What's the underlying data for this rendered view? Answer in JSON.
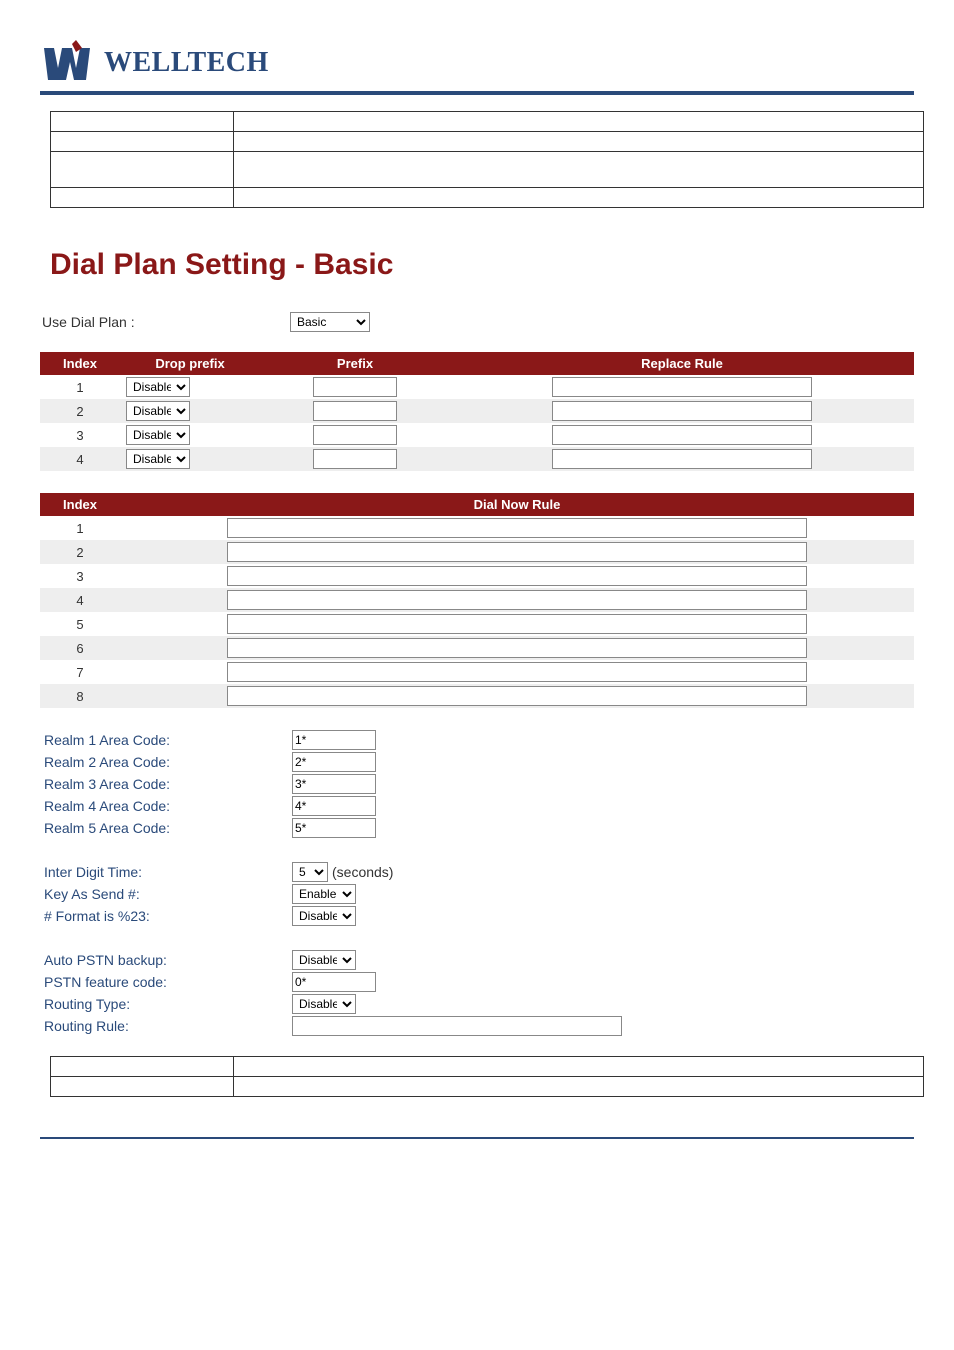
{
  "logo_text": "WELLTECH",
  "title": "Dial Plan Setting - Basic",
  "use_dial_plan": {
    "label": "Use Dial Plan :",
    "value": "Basic"
  },
  "plan_headers": {
    "index": "Index",
    "drop_prefix": "Drop prefix",
    "prefix": "Prefix",
    "replace": "Replace Rule"
  },
  "plan_rows": [
    {
      "index": "1",
      "drop": "Disable",
      "prefix": "",
      "replace": ""
    },
    {
      "index": "2",
      "drop": "Disable",
      "prefix": "",
      "replace": ""
    },
    {
      "index": "3",
      "drop": "Disable",
      "prefix": "",
      "replace": ""
    },
    {
      "index": "4",
      "drop": "Disable",
      "prefix": "",
      "replace": ""
    }
  ],
  "dialnow_headers": {
    "index": "Index",
    "rule": "Dial Now Rule"
  },
  "dialnow_rows": [
    {
      "index": "1",
      "rule": ""
    },
    {
      "index": "2",
      "rule": ""
    },
    {
      "index": "3",
      "rule": ""
    },
    {
      "index": "4",
      "rule": ""
    },
    {
      "index": "5",
      "rule": ""
    },
    {
      "index": "6",
      "rule": ""
    },
    {
      "index": "7",
      "rule": ""
    },
    {
      "index": "8",
      "rule": ""
    }
  ],
  "realms": [
    {
      "label": "Realm 1 Area Code:",
      "value": "1*"
    },
    {
      "label": "Realm 2 Area Code:",
      "value": "2*"
    },
    {
      "label": "Realm 3 Area Code:",
      "value": "3*"
    },
    {
      "label": "Realm 4 Area Code:",
      "value": "4*"
    },
    {
      "label": "Realm 5 Area Code:",
      "value": "5*"
    }
  ],
  "dial_opts": {
    "inter_digit": {
      "label": "Inter Digit Time:",
      "value": "5",
      "unit": "(seconds)"
    },
    "key_as_send": {
      "label": "Key As Send #:",
      "value": "Enable"
    },
    "format23": {
      "label": "# Format is %23:",
      "value": "Disable"
    }
  },
  "pstn": {
    "backup": {
      "label": "Auto PSTN backup:",
      "value": "Disable"
    },
    "feature_code": {
      "label": "PSTN feature code:",
      "value": "0*"
    },
    "routing_type": {
      "label": "Routing Type:",
      "value": "Disable"
    },
    "routing_rule": {
      "label": "Routing Rule:",
      "value": ""
    }
  }
}
